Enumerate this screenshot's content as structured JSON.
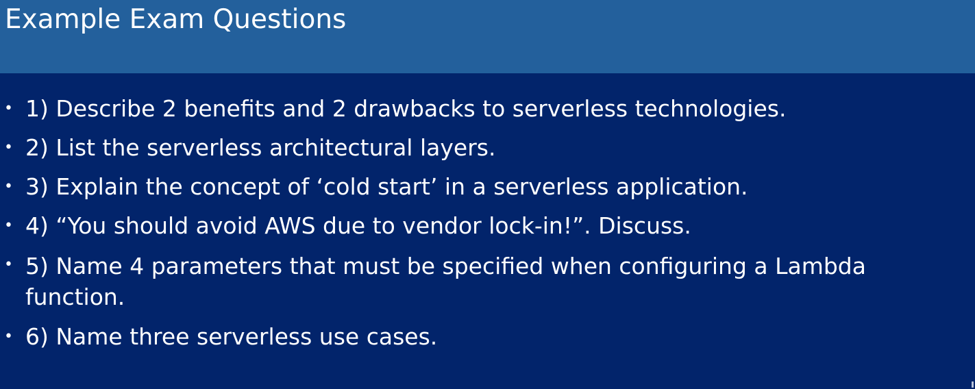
{
  "slide": {
    "title": "Example Exam Questions",
    "bullets": [
      {
        "symbol": "•",
        "text": "1) Describe 2 benefits and 2 drawbacks to serverless technologies."
      },
      {
        "symbol": "•",
        "text": "2) List the serverless architectural layers."
      },
      {
        "symbol": "•",
        "text": "3) Explain the concept of ‘cold start’ in a serverless application."
      },
      {
        "symbol": "•",
        "text": "4) “You should avoid AWS due to vendor lock-in!”.  Discuss."
      },
      {
        "symbol": "•",
        "text": "5) Name 4 parameters that must be specified when configuring a Lambda function."
      },
      {
        "symbol": "•",
        "text": "6) Name three serverless use cases."
      }
    ]
  },
  "colors": {
    "title_bar": "#23609c",
    "body_background": "#02246b",
    "text": "#ffffff"
  }
}
